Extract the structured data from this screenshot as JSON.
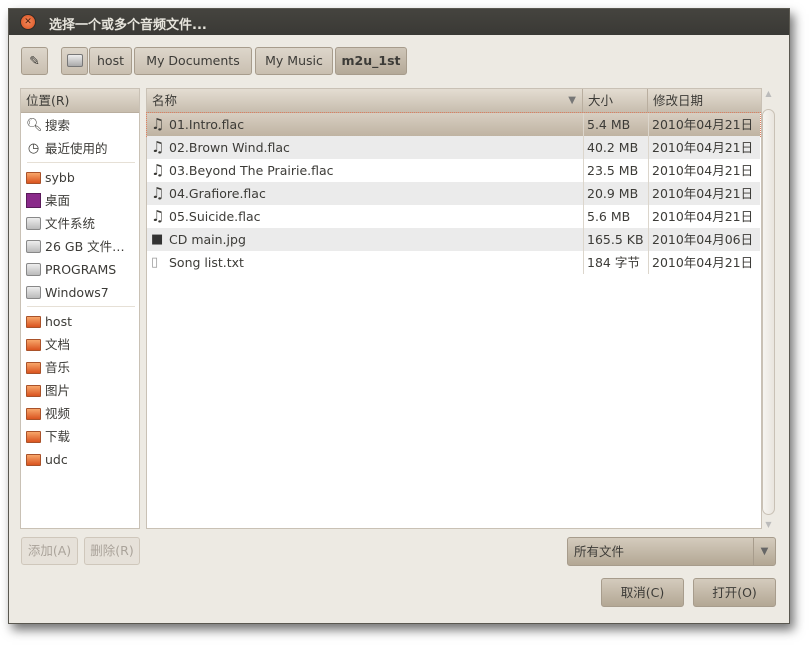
{
  "window": {
    "title": "选择一个或多个音频文件..."
  },
  "pathbar": {
    "items": [
      "host",
      "My Documents",
      "My Music",
      "m2u_1st"
    ]
  },
  "sidebar": {
    "header": "位置(R)",
    "groups": [
      [
        {
          "label": "搜索",
          "icon": "search-icon"
        },
        {
          "label": "最近使用的",
          "icon": "clock-icon"
        }
      ],
      [
        {
          "label": "sybb",
          "icon": "home-folder-icon"
        },
        {
          "label": "桌面",
          "icon": "desktop-icon"
        },
        {
          "label": "文件系统",
          "icon": "drive-icon"
        },
        {
          "label": "26 GB 文件…",
          "icon": "drive-icon"
        },
        {
          "label": "PROGRAMS",
          "icon": "drive-icon"
        },
        {
          "label": "Windows7",
          "icon": "drive-icon"
        }
      ],
      [
        {
          "label": "host",
          "icon": "folder-icon"
        },
        {
          "label": "文档",
          "icon": "documents-folder-icon"
        },
        {
          "label": "音乐",
          "icon": "music-folder-icon"
        },
        {
          "label": "图片",
          "icon": "pictures-folder-icon"
        },
        {
          "label": "视频",
          "icon": "videos-folder-icon"
        },
        {
          "label": "下载",
          "icon": "downloads-folder-icon"
        },
        {
          "label": "udc",
          "icon": "folder-icon"
        }
      ]
    ]
  },
  "filelist": {
    "columns": [
      "名称",
      "大小",
      "修改日期"
    ],
    "rows": [
      {
        "name": "01.Intro.flac",
        "size": "5.4 MB",
        "date": "2010年04月21日",
        "icon": "audio-file-icon"
      },
      {
        "name": "02.Brown Wind.flac",
        "size": "40.2 MB",
        "date": "2010年04月21日",
        "icon": "audio-file-icon"
      },
      {
        "name": "03.Beyond The Prairie.flac",
        "size": "23.5 MB",
        "date": "2010年04月21日",
        "icon": "audio-file-icon"
      },
      {
        "name": "04.Grafiore.flac",
        "size": "20.9 MB",
        "date": "2010年04月21日",
        "icon": "audio-file-icon"
      },
      {
        "name": "05.Suicide.flac",
        "size": "5.6 MB",
        "date": "2010年04月21日",
        "icon": "audio-file-icon"
      },
      {
        "name": "CD main.jpg",
        "size": "165.5 KB",
        "date": "2010年04月06日",
        "icon": "image-file-icon"
      },
      {
        "name": "Song list.txt",
        "size": "184 字节",
        "date": "2010年04月21日",
        "icon": "text-file-icon"
      }
    ]
  },
  "buttons": {
    "add": "添加(A)",
    "remove": "删除(R)",
    "cancel": "取消(C)",
    "open": "打开(O)"
  },
  "filter": {
    "selected": "所有文件"
  }
}
